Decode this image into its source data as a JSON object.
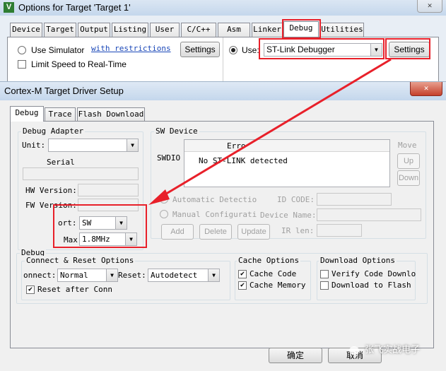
{
  "outer_window": {
    "title": "Options for Target 'Target 1'",
    "close": "✕",
    "tabs": [
      "Device",
      "Target",
      "Output",
      "Listing",
      "User",
      "C/C++",
      "Asm",
      "Linker",
      "Debug",
      "Utilities"
    ],
    "use_simulator_label": "Use Simulator",
    "with_restrictions_link": "with restrictions",
    "settings_left": "Settings",
    "limit_speed_label": "Limit Speed to Real-Time",
    "use_label": "Use:",
    "debugger_value": "ST-Link Debugger",
    "settings_right": "Settings"
  },
  "dialog": {
    "title": "Cortex-M Target Driver Setup",
    "close": "✕",
    "tabs": [
      "Debug",
      "Trace",
      "Flash Download"
    ],
    "debug_adapter": {
      "legend": "Debug Adapter",
      "unit_label": "Unit:",
      "unit_value": "",
      "serial_label": "Serial",
      "hw_version_label": "HW Version:",
      "fw_version_label": "FW Version:",
      "port_label": "ort:",
      "port_value": "SW",
      "max_label": "Max",
      "max_value": "1.8MHz"
    },
    "sw_device": {
      "legend": "SW Device",
      "swdio_label": "SWDIO",
      "error_header": "Erro",
      "error_message": "No ST-LINK detected",
      "move_label": "Move",
      "up_button": "Up",
      "down_button": "Down",
      "auto_detect_label": "Automatic Detectio",
      "manual_config_label": "Manual Configurati",
      "id_code_label": "ID CODE:",
      "device_name_label": "Device Name:",
      "ir_len_label": "IR len:",
      "add_button": "Add",
      "delete_button": "Delete",
      "update_button": "Update"
    },
    "debug_group": {
      "legend": "Debug",
      "connect_reset_legend": "Connect & Reset Options",
      "connect_label": "onnect:",
      "connect_value": "Normal",
      "reset_label": "Reset:",
      "reset_value": "Autodetect",
      "reset_after_conn_label": "Reset after Conn",
      "cache_legend": "Cache Options",
      "cache_code_label": "Cache Code",
      "cache_memory_label": "Cache Memory",
      "download_legend": "Download Options",
      "verify_label": "Verify Code Downlo",
      "download_flash_label": "Download to Flash"
    },
    "ok_button": "确定",
    "cancel_button": "取消"
  },
  "watermark": "张飞实战电子",
  "colors": {
    "highlight": "#e8202a",
    "title_bar": "#c4d7ec"
  }
}
